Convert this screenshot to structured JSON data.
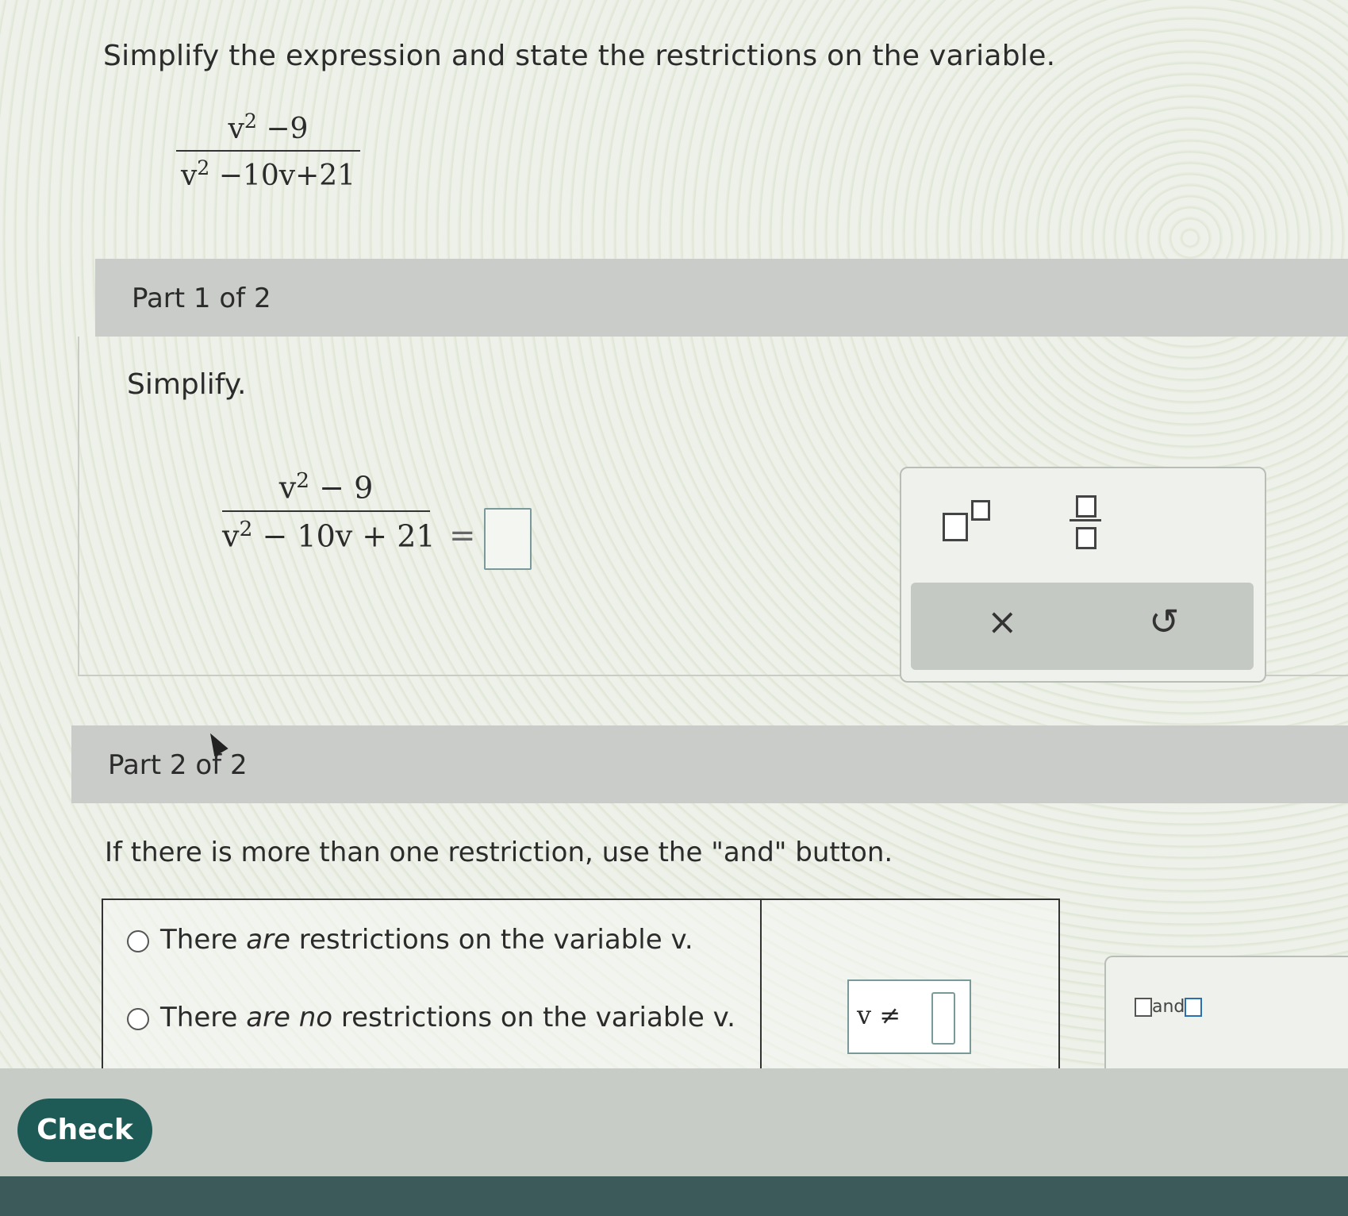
{
  "question": {
    "text": "Simplify the expression and state the restrictions on the variable.",
    "expression": {
      "numerator_base": "v",
      "numerator_rest": " −9",
      "denominator_base": "v",
      "denominator_rest": " −10v+21",
      "exponent": "2"
    }
  },
  "part1": {
    "header": "Part 1 of 2",
    "label": "Simplify.",
    "expression": {
      "numerator_base": "v",
      "numerator_rest": " − 9",
      "denominator_base": "v",
      "denominator_rest": " − 10v + 21",
      "exponent": "2"
    },
    "equals": "="
  },
  "palette": {
    "clear_icon": "×",
    "undo_icon": "↺"
  },
  "part2": {
    "header": "Part 2 of 2",
    "instruction": "If there is more than one restriction, use the \"and\" button.",
    "option1_prefix": "There ",
    "option1_em": "are",
    "option1_suffix": " restrictions on the variable v.",
    "option2_prefix": "There ",
    "option2_em": "are no",
    "option2_suffix": " restrictions on the variable v.",
    "neq_label": "v ≠",
    "and_label": "and",
    "clear_icon": "×"
  },
  "footer": {
    "check_label": "Check"
  },
  "colors": {
    "accent": "#1e5a56",
    "header_bg": "#c9ccc8",
    "box_border": "#7a9a9a"
  }
}
